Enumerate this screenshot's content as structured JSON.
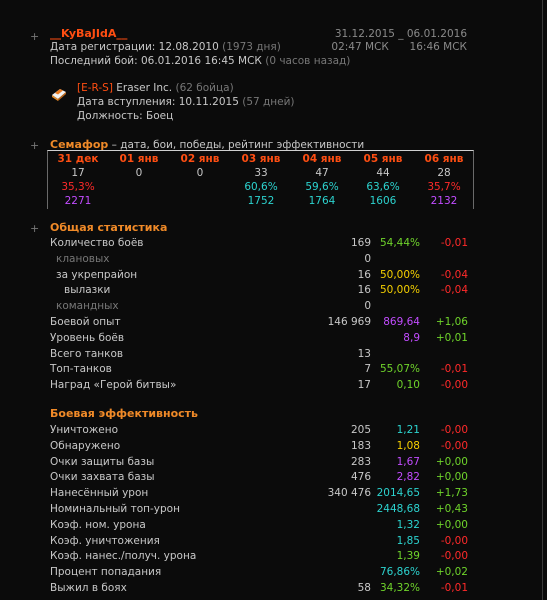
{
  "player": {
    "name": "__KyBaJIdA__",
    "reg_label": "Дата регистрации:",
    "reg_date": "12.08.2010",
    "reg_days": "(1973 дня)",
    "last_label": "Последний бой:",
    "last_date": "06.01.2016 16:45 МСК",
    "last_ago": "(0 часов назад)",
    "date_from": "31.12.2015",
    "date_sep": "_",
    "date_to": "06.01.2016",
    "time_from": "02:47 МСК",
    "time_to": "16:46 МСК"
  },
  "clan": {
    "icon": "eraser-icon",
    "tag": "[E-R-S]",
    "name": "Eraser Inc.",
    "members": "(62 бойца)",
    "join_label": "Дата вступления:",
    "join_date": "10.11.2015",
    "join_days": "(57 дней)",
    "role_label": "Должность:",
    "role": "Боец"
  },
  "semafor": {
    "title": "Семафор",
    "subtitle": " – дата, бои, победы, рейтинг эффективности",
    "days": [
      {
        "date": "31 дек",
        "battles": "17",
        "win": "35,3%",
        "rating": "2271",
        "win_color": "#ff2a2a",
        "rating_color": "#c24cff"
      },
      {
        "date": "01 янв",
        "battles": "0",
        "win": "",
        "rating": "",
        "win_color": "#6fd42b",
        "rating_color": "#2cd3cf"
      },
      {
        "date": "02 янв",
        "battles": "0",
        "win": "",
        "rating": "",
        "win_color": "#6fd42b",
        "rating_color": "#2cd3cf"
      },
      {
        "date": "03 янв",
        "battles": "33",
        "win": "60,6%",
        "rating": "1752",
        "win_color": "#2cd3cf",
        "rating_color": "#2cd3cf"
      },
      {
        "date": "04 янв",
        "battles": "47",
        "win": "59,6%",
        "rating": "1764",
        "win_color": "#2cd3cf",
        "rating_color": "#2cd3cf"
      },
      {
        "date": "05 янв",
        "battles": "44",
        "win": "63,6%",
        "rating": "1606",
        "win_color": "#2cd3cf",
        "rating_color": "#2cd3cf"
      },
      {
        "date": "06 янв",
        "battles": "28",
        "win": "35,7%",
        "rating": "2132",
        "win_color": "#ff2a2a",
        "rating_color": "#c24cff"
      }
    ]
  },
  "general": {
    "title": "Общая статистика",
    "rows": [
      {
        "name": "Количество боёв",
        "value": "169",
        "pct": "54,44%",
        "delta": "-0,01",
        "indent": 0,
        "dim": false,
        "pct_color": "#6fd42b",
        "delta_color": "#ff2a2a"
      },
      {
        "name": "клановых",
        "value": "0",
        "pct": "",
        "delta": "",
        "indent": 1,
        "dim": true,
        "pct_color": "#6fd42b",
        "delta_color": "#ff2a2a"
      },
      {
        "name": "за укрепрайон",
        "value": "16",
        "pct": "50,00%",
        "delta": "-0,04",
        "indent": 1,
        "dim": false,
        "pct_color": "#f5d000",
        "delta_color": "#ff2a2a"
      },
      {
        "name": "вылазки",
        "value": "16",
        "pct": "50,00%",
        "delta": "-0,04",
        "indent": 2,
        "dim": false,
        "pct_color": "#f5d000",
        "delta_color": "#ff2a2a"
      },
      {
        "name": "командных",
        "value": "0",
        "pct": "",
        "delta": "",
        "indent": 1,
        "dim": true,
        "pct_color": "#6fd42b",
        "delta_color": "#ff2a2a"
      },
      {
        "name": "Боевой опыт",
        "value": "146 969",
        "pct": "869,64",
        "delta": "+1,06",
        "indent": 0,
        "dim": false,
        "pct_color": "#c24cff",
        "delta_color": "#6fd42b"
      },
      {
        "name": "Уровень боёв",
        "value": "",
        "pct": "8,9",
        "delta": "+0,01",
        "indent": 0,
        "dim": false,
        "pct_color": "#c24cff",
        "delta_color": "#6fd42b"
      },
      {
        "name": "Всего танков",
        "value": "13",
        "pct": "",
        "delta": "",
        "indent": 0,
        "dim": false,
        "pct_color": "#6fd42b",
        "delta_color": "#6fd42b"
      },
      {
        "name": "Топ-танков",
        "value": "7",
        "pct": "55,07%",
        "delta": "-0,01",
        "indent": 0,
        "dim": false,
        "pct_color": "#6fd42b",
        "delta_color": "#ff2a2a"
      },
      {
        "name": "Наград «Герой битвы»",
        "value": "17",
        "pct": "0,10",
        "delta": "-0,00",
        "indent": 0,
        "dim": false,
        "pct_color": "#6fd42b",
        "delta_color": "#ff2a2a"
      }
    ]
  },
  "efficiency": {
    "title": "Боевая эффективность",
    "rows": [
      {
        "name": "Уничтожено",
        "value": "205",
        "pct": "1,21",
        "delta": "-0,00",
        "pct_color": "#2cd3cf",
        "delta_color": "#ff2a2a"
      },
      {
        "name": "Обнаружено",
        "value": "183",
        "pct": "1,08",
        "delta": "-0,00",
        "pct_color": "#f5d000",
        "delta_color": "#ff2a2a"
      },
      {
        "name": "Очки защиты базы",
        "value": "283",
        "pct": "1,67",
        "delta": "+0,00",
        "pct_color": "#c24cff",
        "delta_color": "#6fd42b"
      },
      {
        "name": "Очки захвата базы",
        "value": "476",
        "pct": "2,82",
        "delta": "+0,00",
        "pct_color": "#c24cff",
        "delta_color": "#6fd42b"
      },
      {
        "name": "Нанесённый урон",
        "value": "340 476",
        "pct": "2014,65",
        "delta": "+1,73",
        "pct_color": "#2cd3cf",
        "delta_color": "#6fd42b"
      },
      {
        "name": "Номинальный топ-урон",
        "value": "",
        "pct": "2448,68",
        "delta": "+0,43",
        "pct_color": "#2cd3cf",
        "delta_color": "#6fd42b"
      },
      {
        "name": "Коэф. ном. урона",
        "value": "",
        "pct": "1,32",
        "delta": "+0,00",
        "pct_color": "#2cd3cf",
        "delta_color": "#6fd42b"
      },
      {
        "name": "Коэф. уничтожения",
        "value": "",
        "pct": "1,85",
        "delta": "-0,00",
        "pct_color": "#2cd3cf",
        "delta_color": "#ff2a2a"
      },
      {
        "name": "Коэф. нанес./получ. урона",
        "value": "",
        "pct": "1,39",
        "delta": "-0,00",
        "pct_color": "#6fd42b",
        "delta_color": "#ff2a2a"
      },
      {
        "name": "Процент попадания",
        "value": "",
        "pct": "76,86%",
        "delta": "+0,02",
        "pct_color": "#2cd3cf",
        "delta_color": "#6fd42b"
      },
      {
        "name": "Выжил в боях",
        "value": "58",
        "pct": "34,32%",
        "delta": "-0,01",
        "pct_color": "#6fd42b",
        "delta_color": "#ff2a2a"
      }
    ]
  },
  "ui": {
    "plus_symbol": "+"
  }
}
